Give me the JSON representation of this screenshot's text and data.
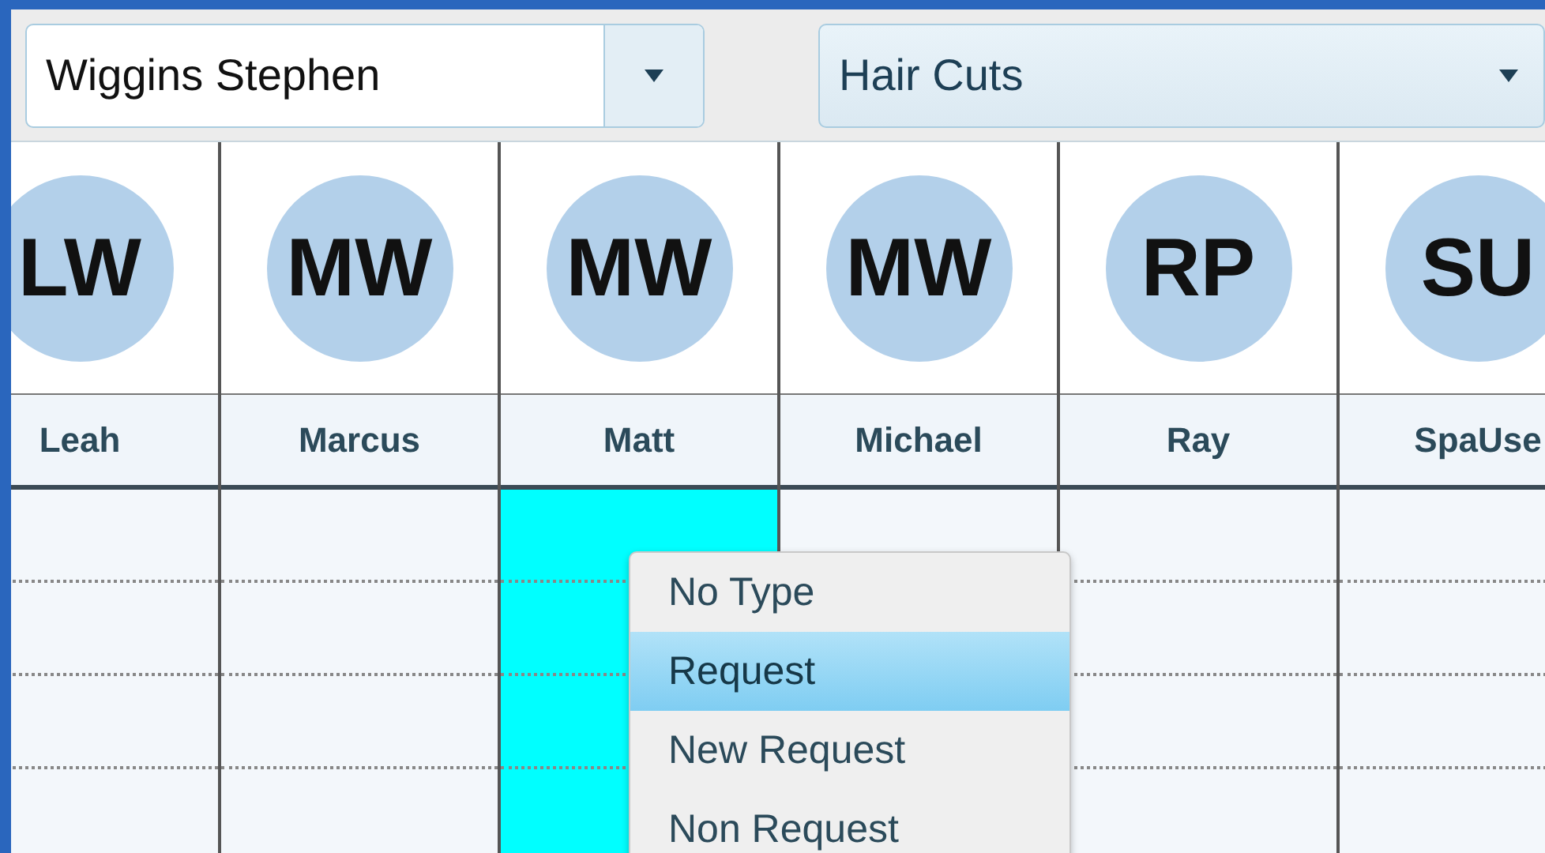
{
  "filters": [
    {
      "kind": "staff",
      "value": "Wiggins Stephen"
    },
    {
      "kind": "service",
      "value": "Hair Cuts"
    }
  ],
  "staff_columns": [
    {
      "initials": "LW",
      "name": "Leah",
      "selected": false
    },
    {
      "initials": "MW",
      "name": "Marcus",
      "selected": false
    },
    {
      "initials": "MW",
      "name": "Matt",
      "selected": true
    },
    {
      "initials": "MW",
      "name": "Michael",
      "selected": false
    },
    {
      "initials": "RP",
      "name": "Ray",
      "selected": false
    },
    {
      "initials": "SU",
      "name": "SpaUse",
      "selected": false
    }
  ],
  "context_menu": {
    "items": [
      {
        "label": "No Type",
        "selected": false
      },
      {
        "label": "Request",
        "selected": true
      },
      {
        "label": "New Request",
        "selected": false
      },
      {
        "label": "Non Request",
        "selected": false
      }
    ]
  }
}
